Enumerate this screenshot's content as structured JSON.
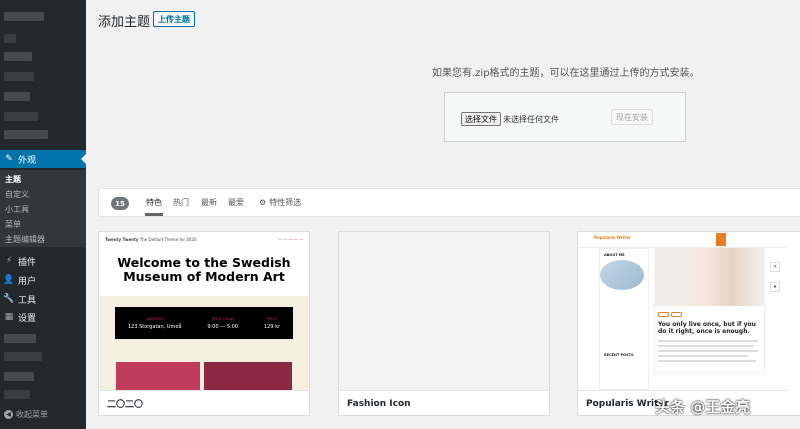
{
  "sidebar": {
    "appearance": "外观",
    "sub_items": [
      "主题",
      "自定义",
      "小工具",
      "菜单",
      "主题编辑器"
    ],
    "plugins": "插件",
    "users": "用户",
    "tools": "工具",
    "settings": "设置",
    "collapse": "收起菜单"
  },
  "header": {
    "title": "添加主题",
    "upload_label": "上传主题"
  },
  "upload": {
    "help": "如果您有.zip格式的主题，可以在这里通过上传的方式安装。",
    "choose_file": "选择文件",
    "no_file": "未选择任何文件",
    "install": "现在安装"
  },
  "filter": {
    "count": "15",
    "tabs": [
      "特色",
      "热门",
      "最新",
      "最爱"
    ],
    "feature_filter": "特性筛选"
  },
  "themes": [
    {
      "name": "二〇二〇",
      "preview": {
        "site_name": "Twenty Twenty",
        "tagline": "The Default Theme for 2020",
        "hero": "Welcome to the Swedish Museum of Modern Art",
        "info": [
          {
            "head": "ADDRESS",
            "value": "123 Storgatan, Umeå"
          },
          {
            "head": "OPEN TODAY",
            "value": "9:00 — 5:00"
          },
          {
            "head": "PRICE",
            "value": "129 kr"
          }
        ]
      }
    },
    {
      "name": "Fashion Icon"
    },
    {
      "name": "Popularis Writer",
      "preview": {
        "logo": "Popularis Writer",
        "headline": "You only live once, but if you do it right, once is enough.",
        "about": "ABOUT ME",
        "recent": "RECENT POSTS"
      }
    }
  ],
  "watermark": "头条 @王金亮"
}
